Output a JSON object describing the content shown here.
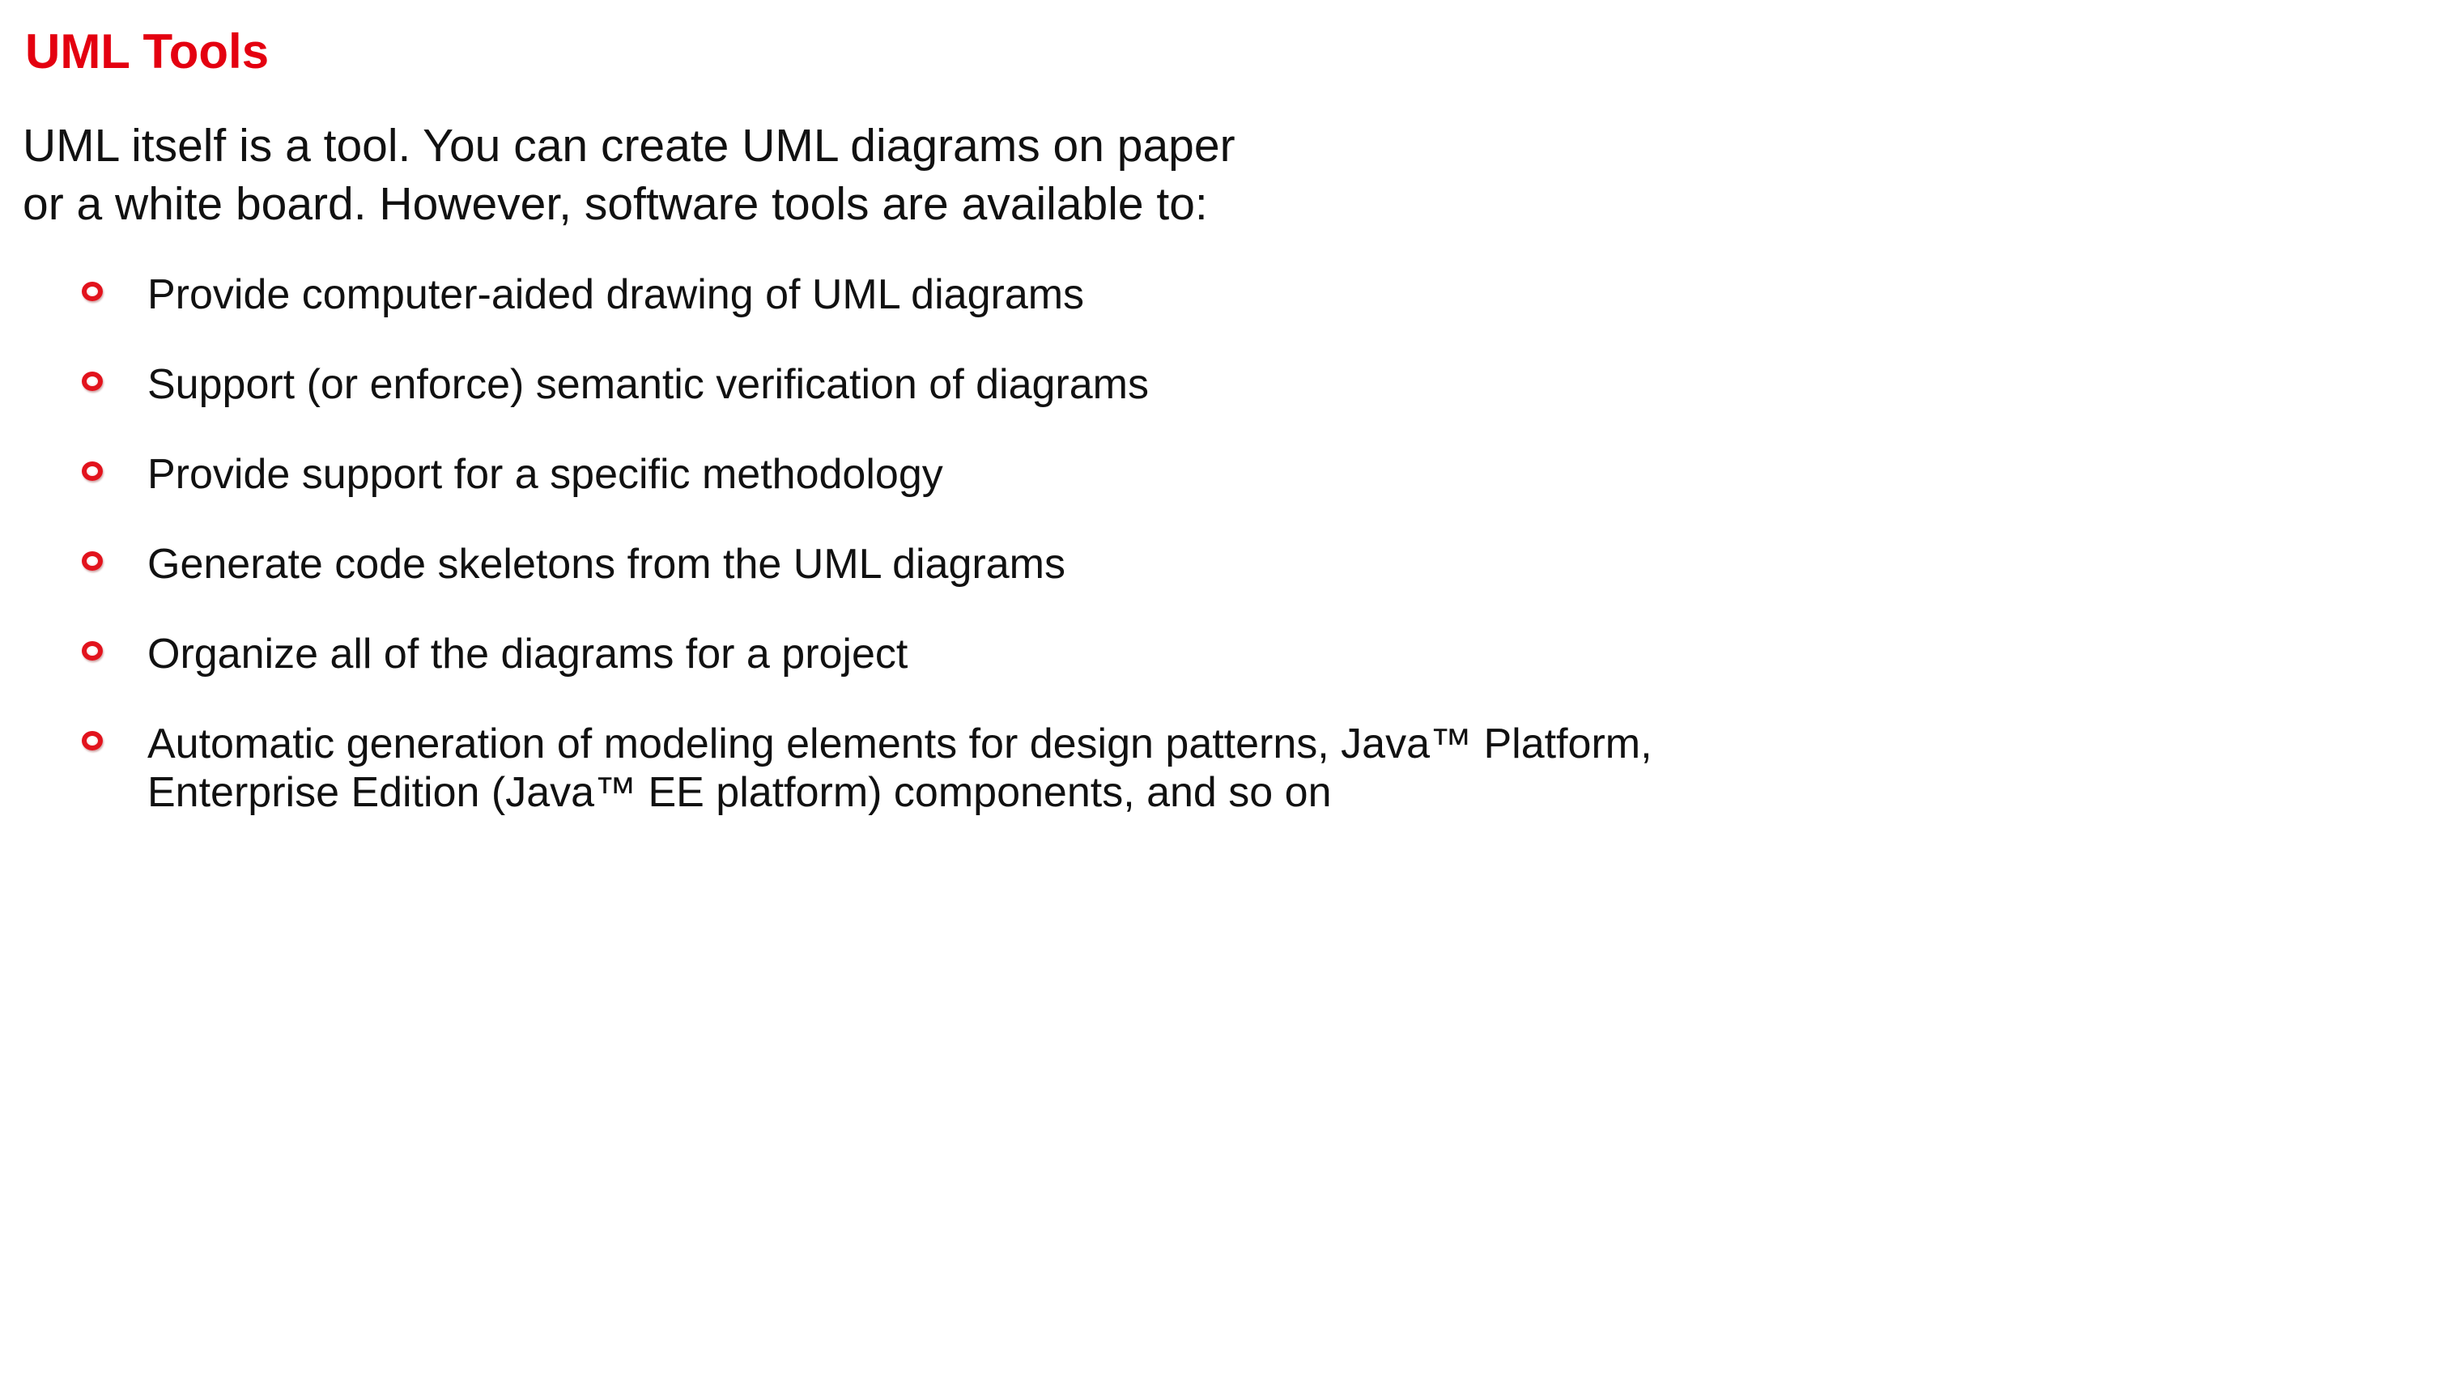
{
  "slide": {
    "title": "UML Tools",
    "intro": "UML itself is a tool. You can create UML diagrams on paper\nor a white board. However, software tools are available to:",
    "bullets": [
      {
        "icon": "red-ring-bullet-icon",
        "text": "Provide computer-aided drawing of UML diagrams"
      },
      {
        "icon": "red-ring-bullet-icon",
        "text": "Support (or enforce) semantic verification of diagrams"
      },
      {
        "icon": "red-ring-bullet-icon",
        "text": "Provide support for a specific methodology"
      },
      {
        "icon": "red-ring-bullet-icon",
        "text": "Generate code skeletons from the UML diagrams"
      },
      {
        "icon": "red-ring-bullet-icon",
        "text": "Organize all of the diagrams for a project"
      },
      {
        "icon": "red-ring-bullet-icon",
        "text": "Automatic generation of modeling elements for design patterns, Java™ Platform,\nEnterprise Edition (Java™ EE platform) components, and so on"
      }
    ]
  },
  "colors": {
    "title": "#e40010",
    "bullet_ring": "#e2131d",
    "text": "#111111",
    "background": "#ffffff"
  }
}
